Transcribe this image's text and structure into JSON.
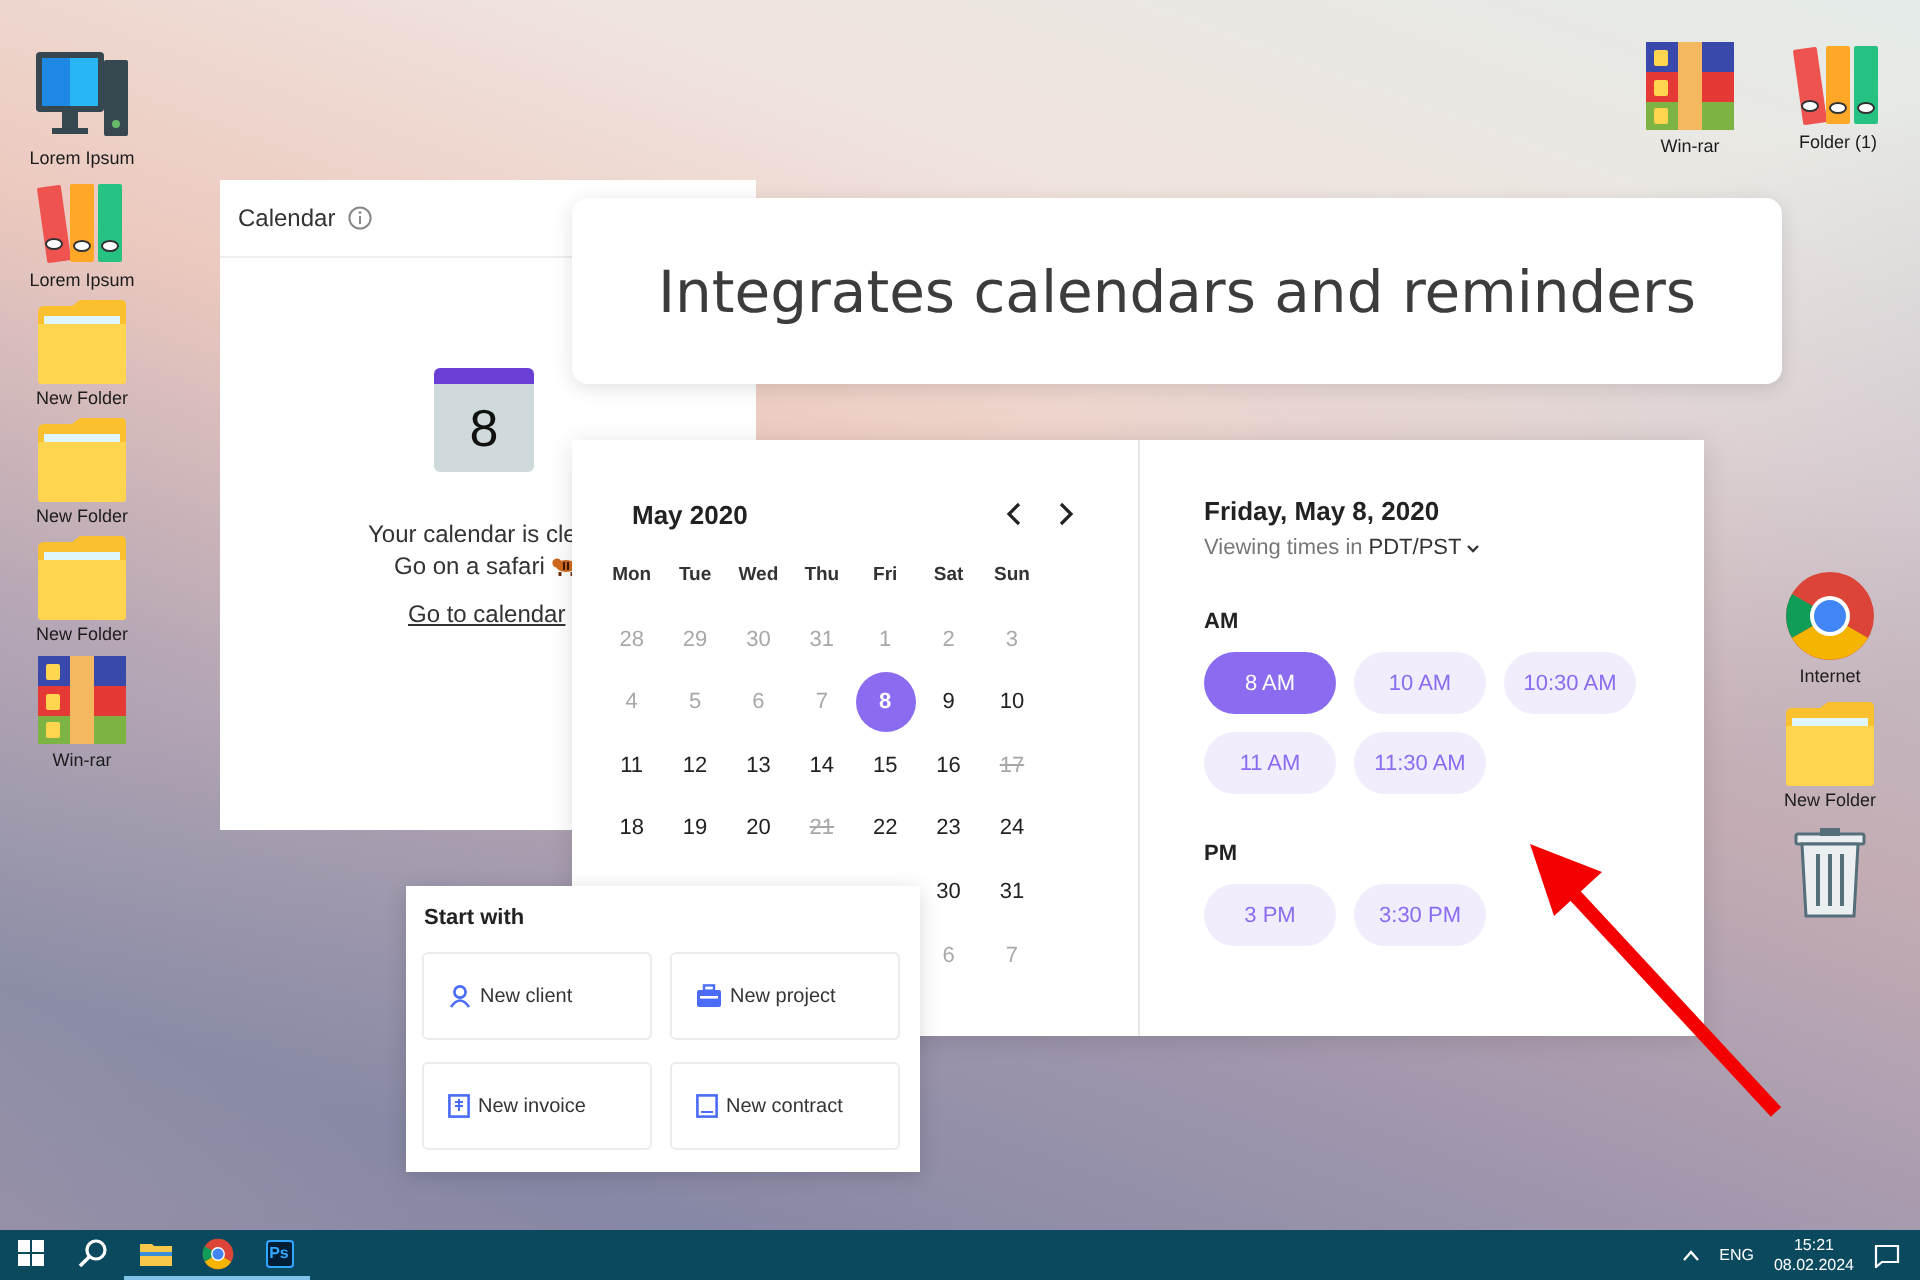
{
  "desktop": {
    "left_icons": [
      {
        "kind": "computer",
        "label": "Lorem Ipsum"
      },
      {
        "kind": "binders",
        "label": "Lorem Ipsum"
      },
      {
        "kind": "folder",
        "label": "New Folder"
      },
      {
        "kind": "folder",
        "label": "New Folder"
      },
      {
        "kind": "folder",
        "label": "New Folder"
      },
      {
        "kind": "archive",
        "label": "Win-rar"
      }
    ],
    "top_right_icons": [
      {
        "kind": "archive",
        "label": "Win-rar"
      },
      {
        "kind": "binders",
        "label": "Folder (1)"
      }
    ],
    "right_icons": [
      {
        "kind": "browser",
        "label": "Internet"
      },
      {
        "kind": "folder",
        "label": "New Folder"
      },
      {
        "kind": "trash"
      }
    ]
  },
  "calendar_panel": {
    "title": "Calendar",
    "icon_day": "8",
    "message_lines": [
      "Your calendar is cle",
      "Go on a safari"
    ],
    "link": "Go to calendar"
  },
  "headline": "Integrates calendars and reminders",
  "date_picker": {
    "month": "May 2020",
    "weekdays": [
      "Mon",
      "Tue",
      "Wed",
      "Thu",
      "Fri",
      "Sat",
      "Sun"
    ],
    "weeks": [
      [
        {
          "label": "28",
          "muted": true,
          "struck": false,
          "selected": false
        },
        {
          "label": "29",
          "muted": true,
          "struck": false,
          "selected": false
        },
        {
          "label": "30",
          "muted": true,
          "struck": false,
          "selected": false
        },
        {
          "label": "31",
          "muted": true,
          "struck": false,
          "selected": false
        },
        {
          "label": "1",
          "muted": true,
          "struck": false,
          "selected": false
        },
        {
          "label": "2",
          "muted": true,
          "struck": false,
          "selected": false
        },
        {
          "label": "3",
          "muted": true,
          "struck": false,
          "selected": false
        }
      ],
      [
        {
          "label": "4",
          "muted": true,
          "struck": false,
          "selected": false
        },
        {
          "label": "5",
          "muted": true,
          "struck": false,
          "selected": false
        },
        {
          "label": "6",
          "muted": true,
          "struck": false,
          "selected": false
        },
        {
          "label": "7",
          "muted": true,
          "struck": false,
          "selected": false
        },
        {
          "label": "8",
          "muted": false,
          "struck": false,
          "selected": true
        },
        {
          "label": "9",
          "muted": false,
          "struck": false,
          "selected": false
        },
        {
          "label": "10",
          "muted": false,
          "struck": false,
          "selected": false
        }
      ],
      [
        {
          "label": "11",
          "muted": false,
          "struck": false,
          "selected": false
        },
        {
          "label": "12",
          "muted": false,
          "struck": false,
          "selected": false
        },
        {
          "label": "13",
          "muted": false,
          "struck": false,
          "selected": false
        },
        {
          "label": "14",
          "muted": false,
          "struck": false,
          "selected": false
        },
        {
          "label": "15",
          "muted": false,
          "struck": false,
          "selected": false
        },
        {
          "label": "16",
          "muted": false,
          "struck": false,
          "selected": false
        },
        {
          "label": "17",
          "muted": true,
          "struck": true,
          "selected": false
        }
      ],
      [
        {
          "label": "18",
          "muted": false,
          "struck": false,
          "selected": false
        },
        {
          "label": "19",
          "muted": false,
          "struck": false,
          "selected": false
        },
        {
          "label": "20",
          "muted": false,
          "struck": false,
          "selected": false
        },
        {
          "label": "21",
          "muted": true,
          "struck": true,
          "selected": false
        },
        {
          "label": "22",
          "muted": false,
          "struck": false,
          "selected": false
        },
        {
          "label": "23",
          "muted": false,
          "struck": false,
          "selected": false
        },
        {
          "label": "24",
          "muted": false,
          "struck": false,
          "selected": false
        }
      ],
      [
        {
          "label": "30",
          "muted": false,
          "struck": false,
          "selected": false
        },
        {
          "label": "31",
          "muted": false,
          "struck": false,
          "selected": false
        }
      ],
      [
        {
          "label": "6",
          "muted": true,
          "struck": false,
          "selected": false
        },
        {
          "label": "7",
          "muted": true,
          "struck": false,
          "selected": false
        }
      ]
    ],
    "date_title": "Friday, May 8, 2020",
    "timezone_prefix": "Viewing times in",
    "timezone": "PDT/PST",
    "groups": [
      {
        "label": "AM",
        "times": [
          {
            "label": "8 AM",
            "selected": true
          },
          {
            "label": "10 AM",
            "selected": false
          },
          {
            "label": "10:30 AM",
            "selected": false
          },
          {
            "label": "11 AM",
            "selected": false
          },
          {
            "label": "11:30 AM",
            "selected": false
          }
        ]
      },
      {
        "label": "PM",
        "times": [
          {
            "label": "3 PM",
            "selected": false
          },
          {
            "label": "3:30 PM",
            "selected": false
          }
        ]
      }
    ]
  },
  "start_card": {
    "title": "Start with",
    "actions": [
      {
        "kind": "client",
        "label": "New client"
      },
      {
        "kind": "project",
        "label": "New project"
      },
      {
        "kind": "invoice",
        "label": "New invoice"
      },
      {
        "kind": "contract",
        "label": "New contract"
      }
    ]
  },
  "taskbar": {
    "apps": [
      {
        "kind": "start",
        "running": false
      },
      {
        "kind": "search",
        "running": false
      },
      {
        "kind": "explorer",
        "running": true
      },
      {
        "kind": "browser",
        "running": true
      },
      {
        "kind": "photoshop",
        "label": "Ps",
        "running": true
      }
    ],
    "language": "ENG",
    "time": "15:21",
    "date": "08.02.2024"
  }
}
